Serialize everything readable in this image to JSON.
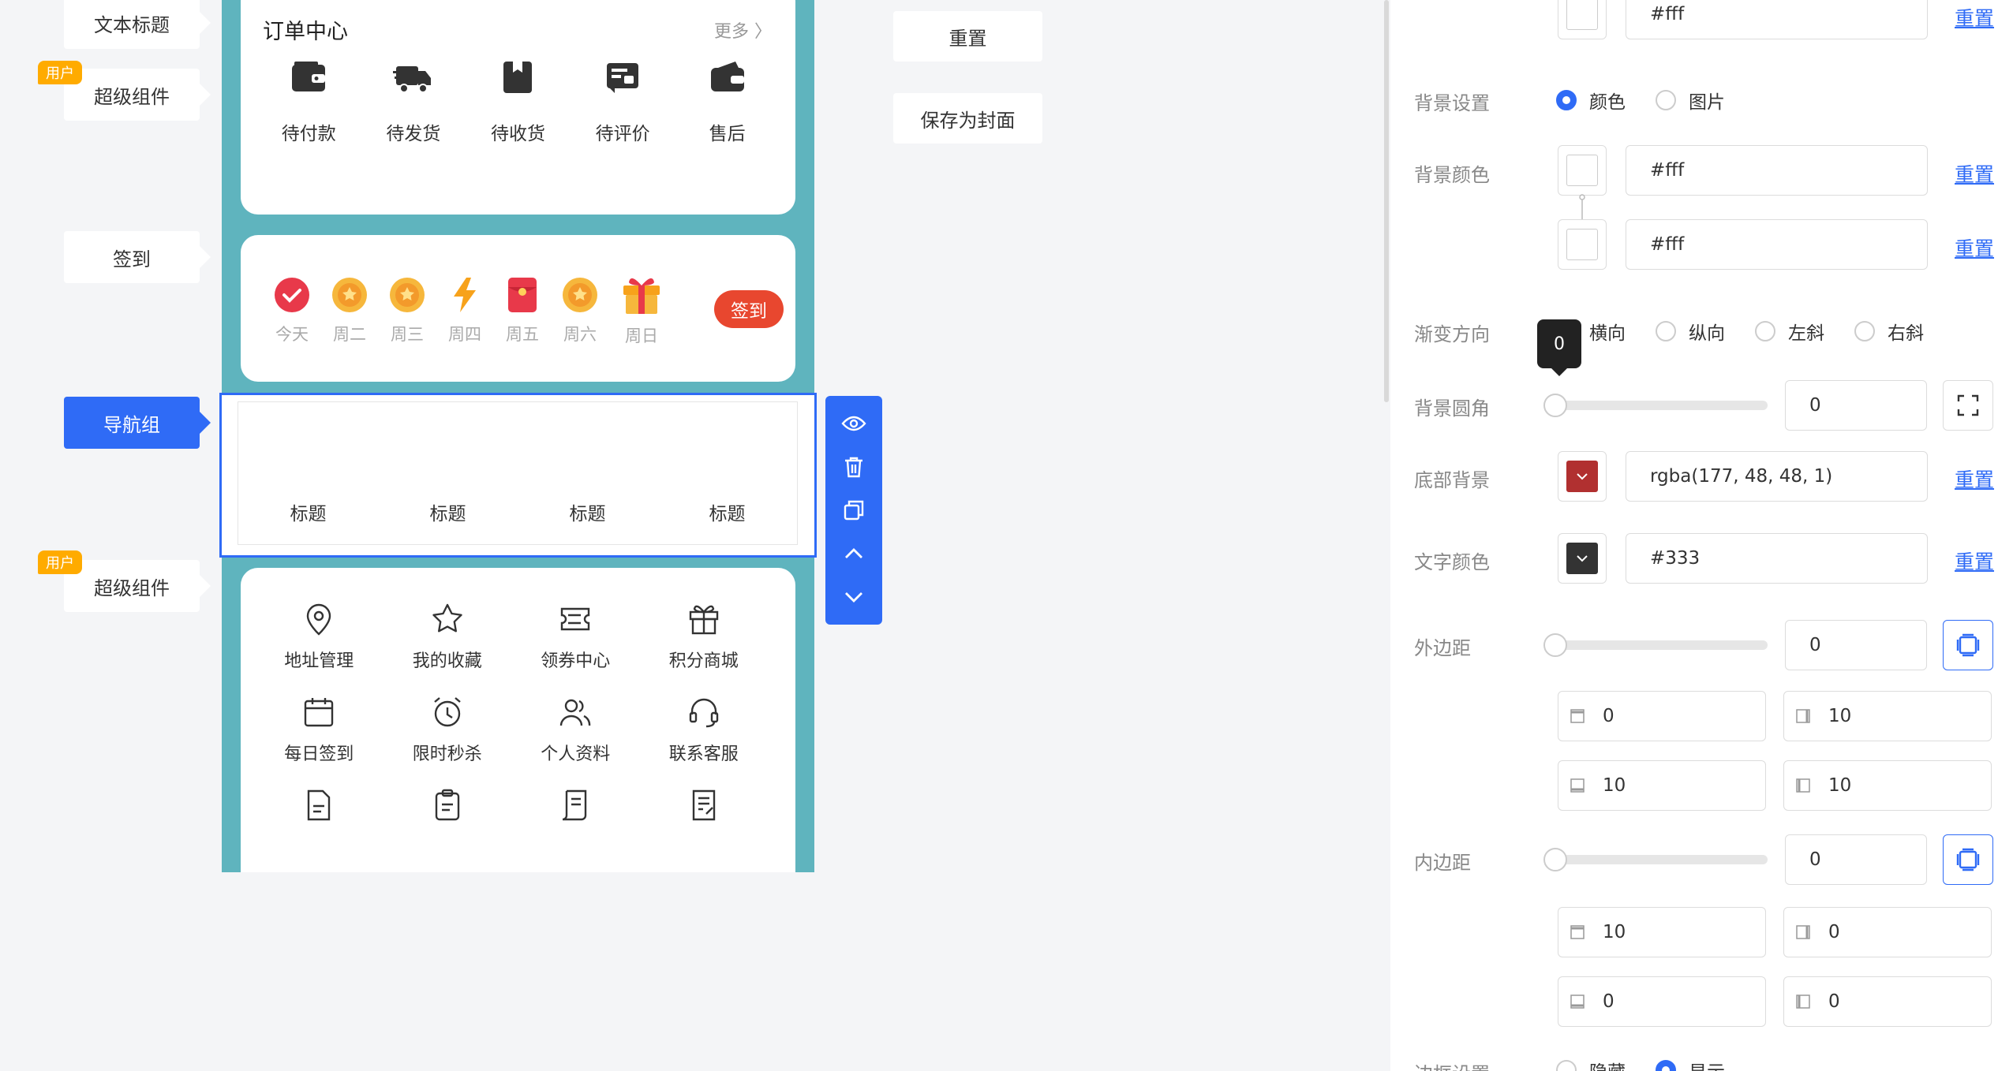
{
  "left_labels": {
    "text_title": "文本标题",
    "super_component_1": "超级组件",
    "user_tag_1": "用户",
    "sign_in": "签到",
    "nav_group": "导航组",
    "super_component_2": "超级组件",
    "user_tag_2": "用户"
  },
  "order_card": {
    "title": "订单中心",
    "more": "更多 〉",
    "items": [
      {
        "label": "待付款",
        "icon": "wallet-icon"
      },
      {
        "label": "待发货",
        "icon": "truck-icon"
      },
      {
        "label": "待收货",
        "icon": "box-icon"
      },
      {
        "label": "待评价",
        "icon": "review-icon"
      },
      {
        "label": "售后",
        "icon": "after-sale-icon"
      }
    ]
  },
  "sign_card": {
    "days": [
      {
        "label": "今天",
        "icon": "check-icon"
      },
      {
        "label": "周二",
        "icon": "coin-icon"
      },
      {
        "label": "周三",
        "icon": "coin-icon"
      },
      {
        "label": "周四",
        "icon": "lightning-icon"
      },
      {
        "label": "周五",
        "icon": "red-envelope-icon"
      },
      {
        "label": "周六",
        "icon": "coin-icon"
      },
      {
        "label": "周日",
        "icon": "gift-icon"
      }
    ],
    "button": "签到"
  },
  "nav_group": {
    "titles": [
      "标题",
      "标题",
      "标题",
      "标题"
    ]
  },
  "toolbar": {
    "icons": [
      "eye-icon",
      "trash-icon",
      "copy-icon",
      "chevron-up-icon",
      "chevron-down-icon"
    ]
  },
  "services": {
    "items": [
      {
        "label": "地址管理",
        "icon": "location-icon"
      },
      {
        "label": "我的收藏",
        "icon": "star-icon"
      },
      {
        "label": "领券中心",
        "icon": "coupon-icon"
      },
      {
        "label": "积分商城",
        "icon": "gift-box-icon"
      },
      {
        "label": "每日签到",
        "icon": "calendar-icon"
      },
      {
        "label": "限时秒杀",
        "icon": "alarm-icon"
      },
      {
        "label": "个人资料",
        "icon": "users-icon"
      },
      {
        "label": "联系客服",
        "icon": "headset-icon"
      },
      {
        "label": "",
        "icon": "document-icon"
      },
      {
        "label": "",
        "icon": "clipboard-icon"
      },
      {
        "label": "",
        "icon": "scroll-icon"
      },
      {
        "label": "",
        "icon": "edit-doc-icon"
      }
    ]
  },
  "middle_buttons": {
    "reset": "重置",
    "save_cover": "保存为封面"
  },
  "panel": {
    "top_color_value": "#fff",
    "reset": "重置",
    "bg_setting_label": "背景设置",
    "bg_type_options": [
      "颜色",
      "图片"
    ],
    "bg_color_label": "背景颜色",
    "bg_color_1": "#fff",
    "bg_color_2": "#fff",
    "gradient_label": "渐变方向",
    "gradient_options": [
      "横向",
      "纵向",
      "左斜",
      "右斜"
    ],
    "radius_label": "背景圆角",
    "radius_value": "0",
    "radius_tooltip": "0",
    "bottom_bg_label": "底部背景",
    "bottom_bg_value": "rgba(177, 48, 48, 1)",
    "bottom_bg_color": "#b13030",
    "text_color_label": "文字颜色",
    "text_color_value": "#333",
    "text_color_swatch": "#333333",
    "margin_label": "外边距",
    "margin_value": "0",
    "margin_top": "0",
    "margin_right": "10",
    "margin_bottom": "10",
    "margin_left": "10",
    "padding_label": "内边距",
    "padding_value": "0",
    "padding_top": "10",
    "padding_right": "0",
    "padding_bottom": "0",
    "padding_left": "0",
    "border_label": "边框设置",
    "border_options": [
      "隐藏",
      "显示"
    ]
  },
  "colors": {
    "accent": "#2f6bf6",
    "canvas_bg": "#5fb4be",
    "sign_button": "#e8472f",
    "user_tag": "#ffab00"
  }
}
